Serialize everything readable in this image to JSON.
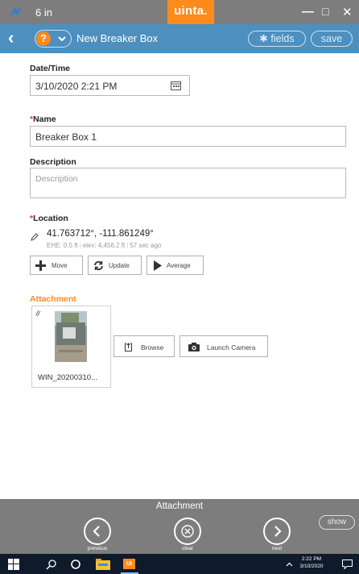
{
  "titlebar": {
    "distance": "6 in",
    "brand": "uinta.",
    "minimize": "—",
    "maximize": "□",
    "close": "✕"
  },
  "header": {
    "back_icon": "chevron-left",
    "help_icon": "question-mark",
    "title": "New Breaker Box",
    "fields_label": "fields",
    "save_label": "save"
  },
  "form": {
    "datetime": {
      "label": "Date/Time",
      "value": "3/10/2020 2:21 PM"
    },
    "name": {
      "label": "Name",
      "value": "Breaker Box 1",
      "required": true
    },
    "description": {
      "label": "Description",
      "value": "",
      "placeholder": "Description"
    },
    "location": {
      "label": "Location",
      "required": true,
      "coords": "41.763712°, -111.861249°",
      "ehe": "EHE: 0.5 ft",
      "elev": "elev: 4,456.2 ft",
      "age": "57 sec ago",
      "buttons": {
        "move": "Move",
        "update": "Update",
        "average": "Average"
      }
    },
    "attachment": {
      "label": "Attachment",
      "filename": "WIN_20200310...",
      "browse_label": "Browse",
      "camera_label": "Launch Camera"
    }
  },
  "bottom_nav": {
    "title": "Attachment",
    "previous": "previous",
    "clear": "clear",
    "next": "next",
    "show": "show"
  },
  "taskbar": {
    "time": "2:22 PM",
    "date": "3/10/2020",
    "app_label": "UI"
  },
  "colors": {
    "accent_orange": "#ff8a1c",
    "header_blue": "#4d8fbf",
    "chrome_gray": "#7d7d7d",
    "required_red": "#e53935",
    "taskbar_dark": "#0f1a2b"
  }
}
